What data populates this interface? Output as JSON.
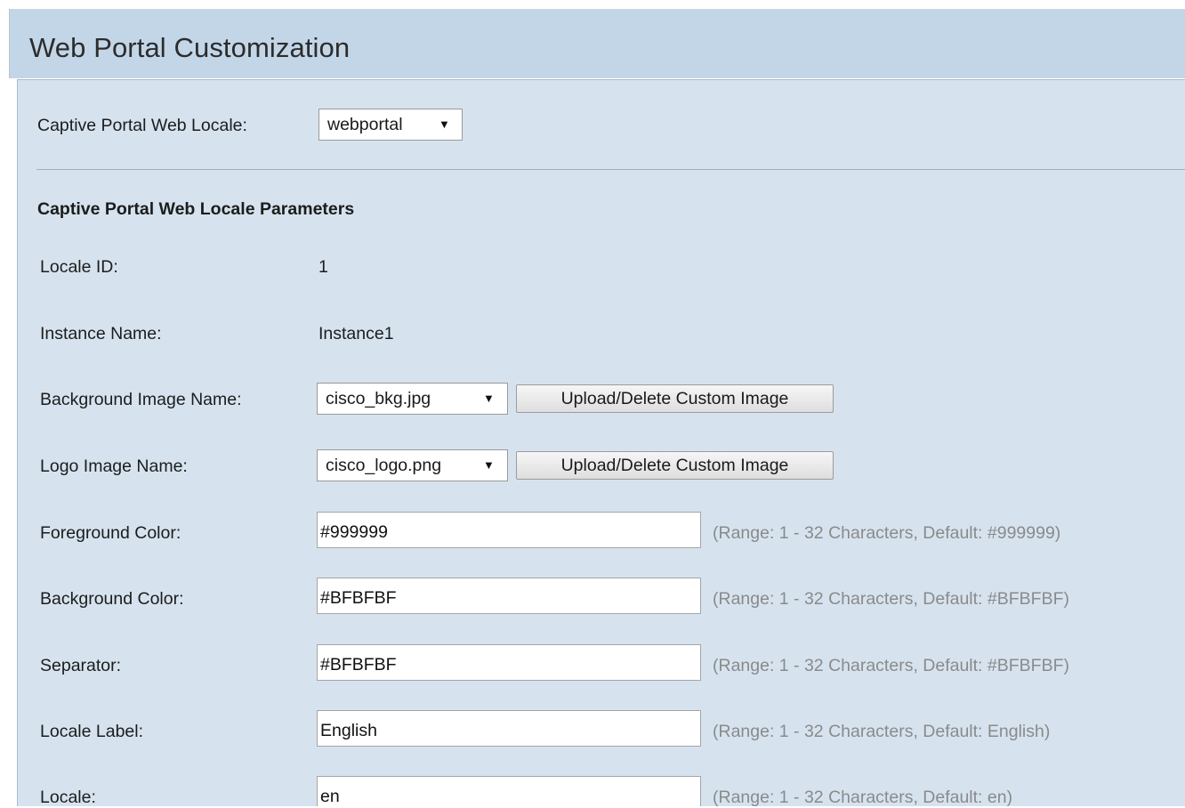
{
  "page": {
    "title": "Web Portal Customization"
  },
  "locale_select": {
    "label": "Captive Portal Web Locale:",
    "value": "webportal",
    "arrow": "▼"
  },
  "section": {
    "heading": "Captive Portal Web Locale Parameters"
  },
  "params": {
    "locale_id": {
      "label": "Locale ID:",
      "value": "1"
    },
    "instance_name": {
      "label": "Instance Name:",
      "value": "Instance1"
    },
    "background_image": {
      "label": "Background Image Name:",
      "value": "cisco_bkg.jpg",
      "arrow": "▼",
      "button": "Upload/Delete Custom Image"
    },
    "logo_image": {
      "label": "Logo Image Name:",
      "value": "cisco_logo.png",
      "arrow": "▼",
      "button": "Upload/Delete Custom Image"
    },
    "foreground_color": {
      "label": "Foreground Color:",
      "value": "#999999",
      "hint": "(Range: 1 - 32 Characters, Default: #999999)"
    },
    "background_color": {
      "label": "Background Color:",
      "value": "#BFBFBF",
      "hint": "(Range: 1 - 32 Characters, Default: #BFBFBF)"
    },
    "separator": {
      "label": "Separator:",
      "value": "#BFBFBF",
      "hint": "(Range: 1 - 32 Characters, Default: #BFBFBF)"
    },
    "locale_label": {
      "label": "Locale Label:",
      "value": "English",
      "hint": "(Range: 1 - 32 Characters, Default: English)"
    },
    "locale": {
      "label": "Locale:",
      "value": "en",
      "hint": "(Range: 1 - 32 Characters, Default: en)"
    }
  },
  "colors": {
    "header_bg": "#c3d6e8",
    "panel_bg": "#d6e3ef",
    "hint_text": "#8a8a8a"
  }
}
